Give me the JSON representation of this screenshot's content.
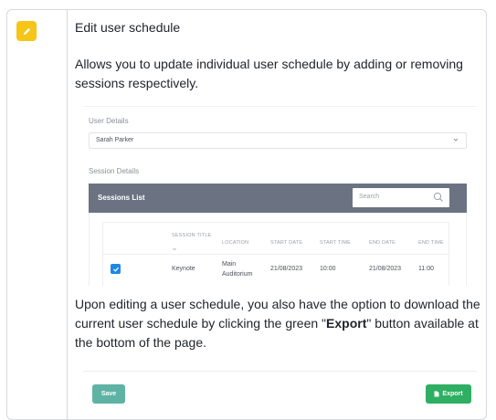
{
  "step": {
    "icon": "pencil-icon",
    "title": "Edit user schedule",
    "description": "Allows you to update individual user schedule by adding or removing sessions respectively.",
    "paragraph2_before": "Upon editing a user schedule, you also have the option to download the current user schedule by clicking the green \"",
    "paragraph2_bold": "Export",
    "paragraph2_after": "\" button available at the bottom of the page."
  },
  "screenshot1": {
    "user_details_label": "User Details",
    "user_select_value": "Sarah Parker",
    "session_details_label": "Session Details",
    "sessions_list_title": "Sessions List",
    "search_placeholder": "Search",
    "columns": [
      "SESSION TITLE",
      "LOCATION",
      "START DATE",
      "START TIME",
      "END DATE",
      "END TIME"
    ],
    "row": {
      "checked": true,
      "session_title": "Keynote",
      "location": "Main Auditorium",
      "start_date": "21/08/2023",
      "start_time": "10:00",
      "end_date": "21/08/2023",
      "end_time": "11:00"
    }
  },
  "screenshot2": {
    "save_label": "Save",
    "export_label": "Export"
  },
  "colors": {
    "badge": "#f5c518",
    "sessions_header": "#6b7383",
    "checkbox": "#1e88e5",
    "save_button": "#5eb3a4",
    "export_button": "#2eaf63"
  }
}
